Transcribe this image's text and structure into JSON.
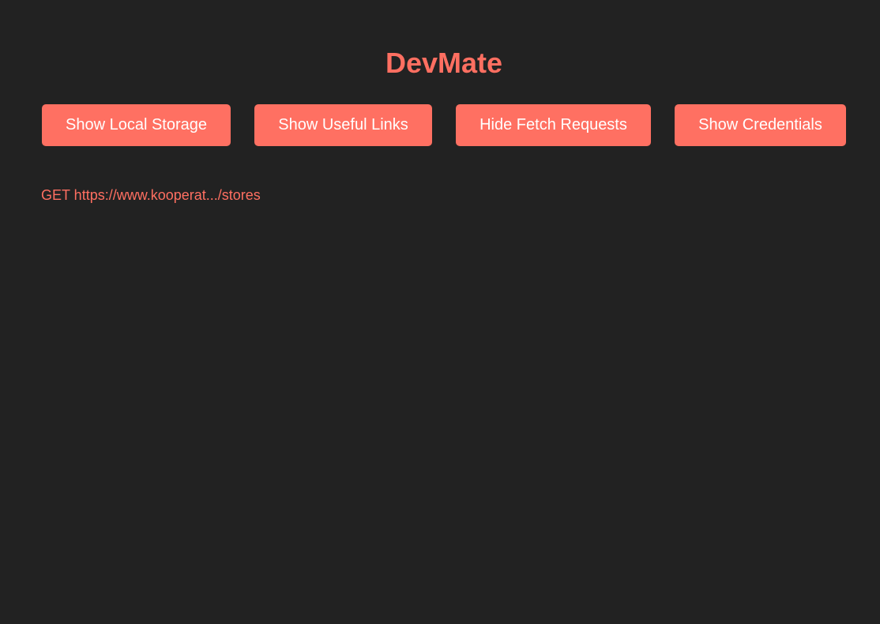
{
  "app": {
    "title": "DevMate",
    "accent_color": "#ff6f61",
    "background_color": "#222222",
    "button_text_color": "#ffffff"
  },
  "toolbar": {
    "buttons": [
      {
        "label": "Show Local Storage"
      },
      {
        "label": "Show Useful Links"
      },
      {
        "label": "Hide Fetch Requests"
      },
      {
        "label": "Show Credentials"
      }
    ]
  },
  "fetch_requests": [
    {
      "text": "GET https://www.kooperat.../stores"
    }
  ]
}
